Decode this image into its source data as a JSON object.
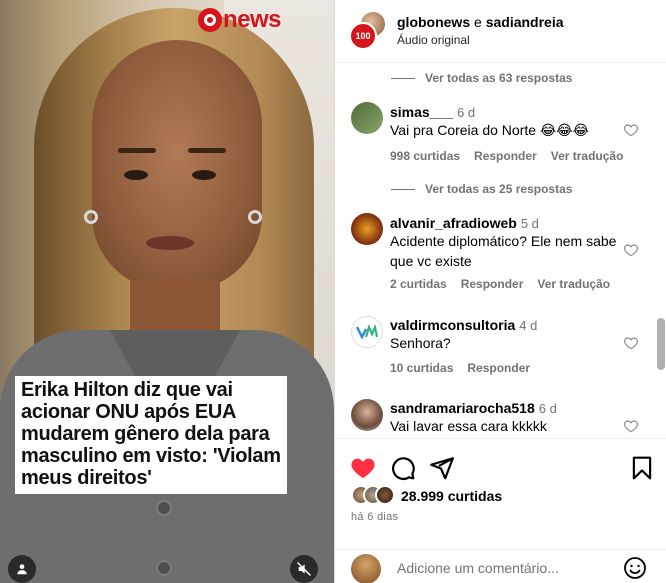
{
  "video": {
    "logo_text": "news",
    "caption": "Erika Hilton diz que vai acionar ONU após EUA mudarem gênero dela para masculino em visto: 'Violam meus direitos'"
  },
  "header": {
    "user1": "globonews",
    "joiner": "e",
    "user2": "sadiandreia",
    "audio": "Áudio original",
    "badge_text": "100"
  },
  "comments": {
    "view_all_1": "Ver todas as 63 respostas",
    "items": [
      {
        "user": "simas___",
        "time": "6 d",
        "text": "Vai pra Coreia do Norte 😂😂😂",
        "likes": "998 curtidas",
        "reply": "Responder",
        "translate": "Ver tradução"
      },
      {
        "user": "alvanir_afradioweb",
        "time": "5 d",
        "text": "Acidente diplomático? Ele nem sabe que vc existe",
        "likes": "2 curtidas",
        "reply": "Responder",
        "translate": "Ver tradução"
      },
      {
        "user": "valdirmconsultoria",
        "time": "4 d",
        "text": "Senhora?",
        "likes": "10 curtidas",
        "reply": "Responder",
        "translate": ""
      },
      {
        "user": "sandramariarocha518",
        "time": "6 d",
        "text": "Vai lavar essa cara kkkkk",
        "likes": "",
        "reply": "",
        "translate": ""
      }
    ],
    "view_all_2": "Ver todas as 25 respostas"
  },
  "footer": {
    "likes": "28.999 curtidas",
    "ago": "há 6 dias",
    "add_comment_placeholder": "Adicione um comentário..."
  },
  "colors": {
    "brand_red": "#d4161c",
    "liked_red": "#ff3040",
    "muted": "#737373"
  },
  "icons": [
    "heart-icon",
    "comment-icon",
    "share-icon",
    "bookmark-icon",
    "emoji-icon",
    "mute-icon",
    "user-icon"
  ]
}
